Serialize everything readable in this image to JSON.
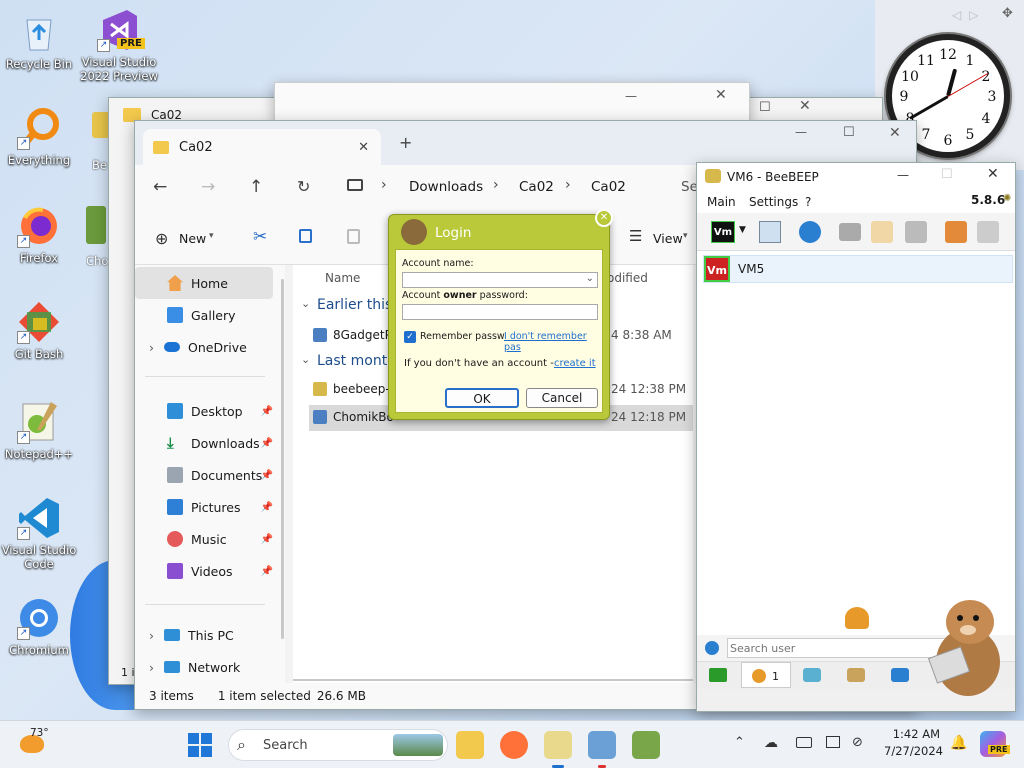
{
  "desktop": {
    "icons": [
      {
        "label": "Recycle Bin",
        "icon": "recycle-bin-icon"
      },
      {
        "label": "Visual Studio 2022 Preview",
        "icon": "visual-studio-icon",
        "badge": "PRE"
      },
      {
        "label": "Everything",
        "icon": "everything-search-icon"
      },
      {
        "label": "Firefox",
        "icon": "firefox-icon"
      },
      {
        "label": "Git Bash",
        "icon": "git-bash-icon"
      },
      {
        "label": "Notepad++",
        "icon": "notepad-plus-plus-icon"
      },
      {
        "label": "Visual Studio Code",
        "icon": "vscode-icon"
      },
      {
        "label": "Chromium",
        "icon": "chromium-icon"
      },
      {
        "label": "Be",
        "icon": "partially-hidden-icon"
      },
      {
        "label": "Cho",
        "icon": "partially-hidden-icon"
      }
    ]
  },
  "clock_gadget": {
    "numbers": [
      "12",
      "1",
      "2",
      "3",
      "4",
      "5",
      "6",
      "7",
      "8",
      "9",
      "10",
      "11"
    ]
  },
  "back_window": {
    "title": "Ca02",
    "status_fragment": "1 i"
  },
  "explorer": {
    "tab_title": "Ca02",
    "breadcrumb": [
      "Downloads",
      "Ca02",
      "Ca02"
    ],
    "search_fragment": "Se",
    "toolbar": {
      "new_label": "New",
      "view_label": "View"
    },
    "column_name": "Name",
    "column_modified_fragment": "odified",
    "groups": [
      {
        "label": "Earlier this",
        "files": [
          {
            "name": "8GadgetPa",
            "modified": "4 8:38 AM"
          }
        ]
      },
      {
        "label": "Last month",
        "files": [
          {
            "name": "beebeep-s",
            "modified": "24 12:38 PM"
          },
          {
            "name": "ChomikBo",
            "modified": "24 12:18 PM",
            "selected": true
          }
        ]
      }
    ],
    "nav": {
      "home": "Home",
      "gallery": "Gallery",
      "onedrive": "OneDrive",
      "pinned": [
        "Desktop",
        "Downloads",
        "Documents",
        "Pictures",
        "Music",
        "Videos"
      ],
      "this_pc": "This PC",
      "network": "Network"
    },
    "status": {
      "items": "3 items",
      "selected": "1 item selected",
      "size": "26.6 MB"
    }
  },
  "login_dialog": {
    "title": "Login",
    "account_name_label": "Account name:",
    "password_label_pre": "Account ",
    "password_label_bold": "owner",
    "password_label_post": " password:",
    "remember_label": "Remember passw",
    "forgot_link": "I don't remember pas",
    "no_account_text": "If you don't have an account - ",
    "create_link": "create it",
    "ok_label": "OK",
    "cancel_label": "Cancel",
    "accent": "#b9c93a"
  },
  "beebeep": {
    "title": "VM6 - BeeBEEP",
    "menu": [
      "Main",
      "Settings",
      "?"
    ],
    "version": "5.8.6",
    "avatar_text": "Vm",
    "user": "VM5",
    "search_placeholder": "Search user",
    "tab_count": "1"
  },
  "taskbar": {
    "weather_temp": "73°",
    "search_label": "Search",
    "time": "1:42 AM",
    "date": "7/27/2024",
    "copilot_badge": "PRE"
  }
}
